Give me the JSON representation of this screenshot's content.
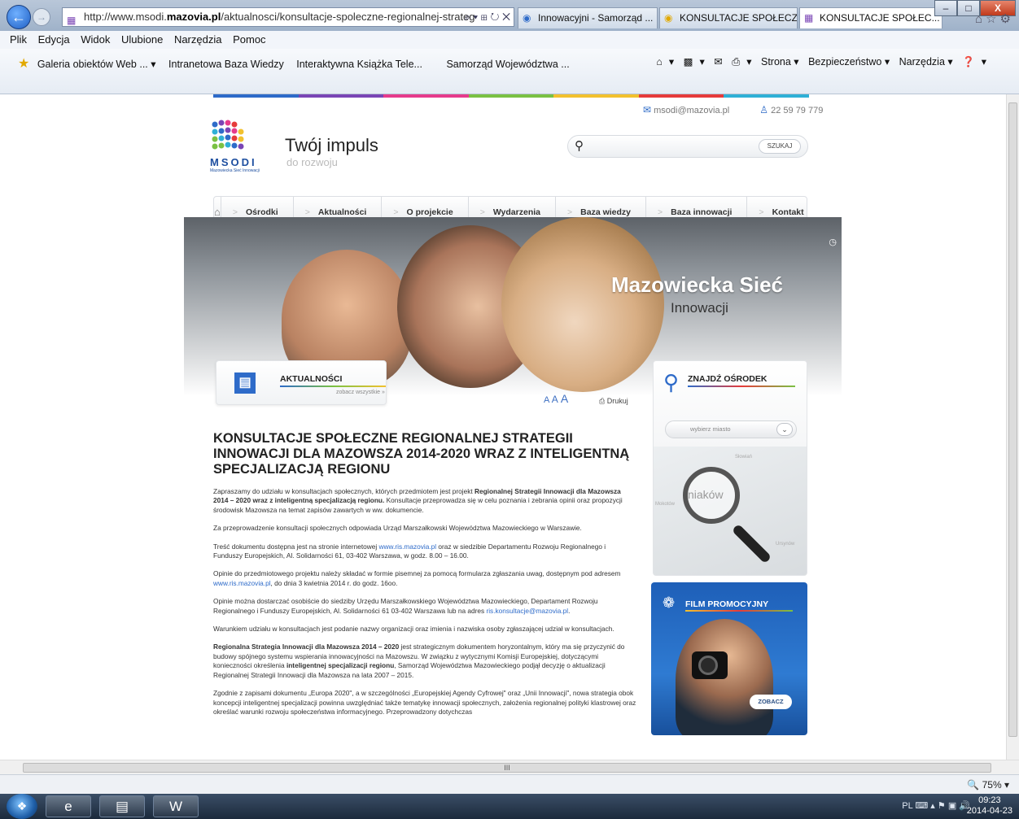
{
  "browser": {
    "url_prefix": "http://www.msodi.",
    "url_domain": "mazovia.pl",
    "url_path": "/aktualnosci/konsultacje-spoleczne-regionalnej-strateg",
    "url_controls": "⌕ ▾ ⊞ ↻ ✕",
    "tabs": [
      {
        "label": "Innowacyjni - Samorząd ...",
        "active": false
      },
      {
        "label": "KONSULTACJE SPOŁECZN...",
        "active": false
      },
      {
        "label": "KONSULTACJE SPOŁEC... ×",
        "active": true
      }
    ],
    "window_buttons": {
      "minimize": "–",
      "maximize": "□",
      "close": "X"
    },
    "toolbar_icons": "⌂☆⚙",
    "menu": [
      "Plik",
      "Edycja",
      "Widok",
      "Ulubione",
      "Narzędzia",
      "Pomoc"
    ],
    "favorites": [
      "Galeria obiektów Web ... ▾",
      "Intranetowa Baza Wiedzy",
      "Interaktywna Książka Tele...",
      "Samorząd Województwa ..."
    ],
    "commands": [
      "▾",
      "▾",
      "▾",
      "Strona ▾",
      "Bezpieczeństwo ▾",
      "Narzędzia ▾",
      "▾"
    ],
    "zoom": "75%",
    "hscroll_label": "III"
  },
  "taskbar": {
    "tray": "PL",
    "time": "09:23",
    "date": "2014-04-23"
  },
  "site": {
    "stripe_colors": [
      "#2e6bc9",
      "#7a45b5",
      "#e63b8c",
      "#7ac143",
      "#f2c12e",
      "#e63b3b",
      "#2fb0d6"
    ],
    "email": "msodi@mazovia.pl",
    "phone": "22 59 79 779",
    "logo_text": "MSODI",
    "logo_sub": "Mazowiecka Sieć Innowacji",
    "slogan": "Twój impuls",
    "slogan_sub": "do rozwoju",
    "search_button": "SZUKAJ",
    "nav": [
      "Ośrodki",
      "Aktualności",
      "O projekcie",
      "Wydarzenia",
      "Baza wiedzy",
      "Baza innowacji",
      "Kontakt"
    ],
    "hero_title": "Mazowiecka Sieć",
    "hero_subtitle": "Innowacji",
    "news_heading": "AKTUALNOŚCI",
    "news_more": "zobacz wszystkie »",
    "font_sizes": [
      "A",
      "A",
      "A"
    ],
    "print_label": "Drukuj",
    "find_heading": "ZNAJDŹ OŚRODEK",
    "city_select": "wybierz miasto",
    "map_labels": [
      "Słowiań",
      "Mokotów",
      "Ursynów"
    ],
    "map_lens_text": "niaków",
    "film_heading": "FILM PROMOCYJNY",
    "film_button": "ZOBACZ",
    "accent": "#2e6bc9"
  },
  "article": {
    "title": "KONSULTACJE SPOŁECZNE REGIONALNEJ STRATEGII INNOWACJI DLA MAZOWSZA 2014-2020 WRAZ Z INTELIGENTNĄ SPECJALIZACJĄ REGIONU",
    "p1_a": "Zapraszamy do udziału w konsultacjach społecznych, których przedmiotem jest projekt ",
    "p1_b": "Regionalnej Strategii Innowacji dla Mazowsza 2014 – 2020 wraz z inteligentną specjalizacją regionu.",
    "p1_c": " Konsultacje przeprowadza się w celu poznania i zebrania opinii oraz propozycji środowisk Mazowsza na temat zapisów zawartych w ww. dokumencie.",
    "p2": "Za przeprowadzenie konsultacji społecznych odpowiada Urząd Marszałkowski Województwa Mazowieckiego w Warszawie.",
    "p3_a": "Treść dokumentu dostępna jest na stronie internetowej ",
    "p3_link": "www.ris.mazovia.pl",
    "p3_b": " oraz w siedzibie Departamentu Rozwoju Regionalnego i Funduszy Europejskich, Al. Solidarności 61, 03-402 Warszawa, w godz. 8.00 – 16.00.",
    "p4_a": "Opinie do przedmiotowego projektu należy składać w formie pisemnej za pomocą formularza zgłaszania uwag, dostępnym pod adresem ",
    "p4_link": "www.ris.mazovia.pl",
    "p4_b": ", do dnia 3 kwietnia 2014 r. do godz. 16oo.",
    "p5_a": "Opinie można dostarczać osobiście do siedziby Urzędu Marszałkowskiego Województwa Mazowieckiego, Departament Rozwoju Regionalnego i Funduszy Europejskich, Al. Solidarności 61 03-402 Warszawa lub na adres ",
    "p5_link": "ris.konsultacje@mazovia.pl",
    "p5_b": ".",
    "p6": "Warunkiem udziału w konsultacjach jest podanie nazwy organizacji oraz imienia i nazwiska osoby zgłaszającej udział w konsultacjach.",
    "p7_a": "Regionalna Strategia Innowacji dla Mazowsza 2014 – 2020",
    "p7_b": " jest strategicznym dokumentem horyzontalnym, który ma się przyczynić do budowy spójnego systemu wspierania innowacyjności na Mazowszu. W związku z wytycznymi Komisji Europejskiej, dotyczącymi konieczności określenia ",
    "p7_c": "inteligentnej specjalizacji regionu",
    "p7_d": ", Samorząd Województwa Mazowieckiego podjął decyzję o aktualizacji Regionalnej Strategii Innowacji dla Mazowsza na lata 2007 – 2015.",
    "p8": "Zgodnie z zapisami dokumentu „Europa 2020\", a w szczególności „Europejskiej Agendy Cyfrowej\" oraz „Unii Innowacji\", nowa strategia obok koncepcji inteligentnej specjalizacji powinna uwzględniać także tematykę innowacji społecznych, założenia regionalnej polityki klastrowej oraz określać warunki rozwoju społeczeństwa informacyjnego. Przeprowadzony dotychczas"
  }
}
